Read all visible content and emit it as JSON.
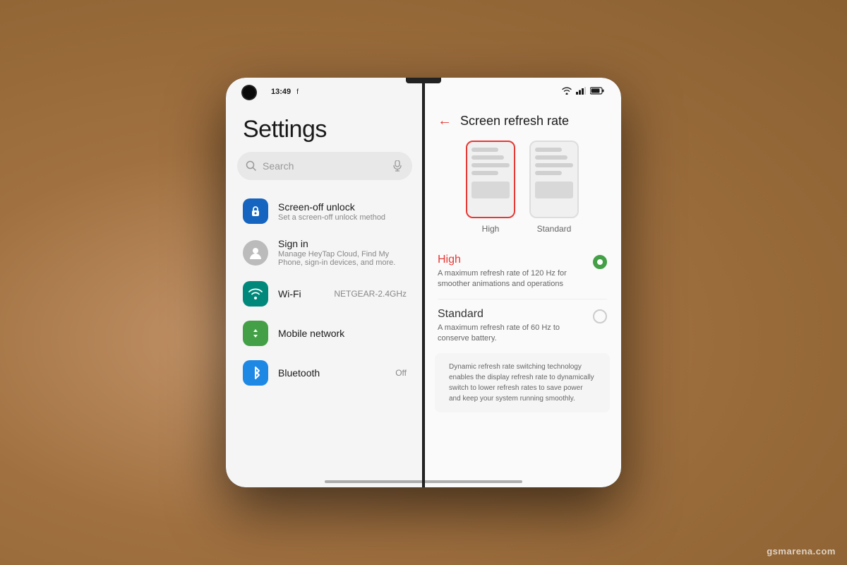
{
  "device": {
    "time": "13:49",
    "fb_indicator": "f",
    "wifi": "▲",
    "battery": "▮▮▮",
    "signal": "▮▮"
  },
  "left_panel": {
    "title": "Settings",
    "search": {
      "placeholder": "Search"
    },
    "items": [
      {
        "id": "screen-off-unlock",
        "icon": "🔒",
        "icon_color": "blue",
        "title": "Screen-off unlock",
        "subtitle": "Set a screen-off unlock method"
      },
      {
        "id": "sign-in",
        "icon": "👤",
        "icon_color": "gray",
        "title": "Sign in",
        "subtitle": "Manage HeyTap Cloud, Find My Phone, sign-in devices, and more."
      },
      {
        "id": "wifi",
        "icon": "wifi",
        "icon_color": "blue",
        "title": "Wi-Fi",
        "value": "NETGEAR-2.4GHz",
        "subtitle": ""
      },
      {
        "id": "mobile-network",
        "icon": "↑↓",
        "icon_color": "green",
        "title": "Mobile network",
        "subtitle": ""
      },
      {
        "id": "bluetooth",
        "icon": "bluetooth",
        "icon_color": "blue2",
        "title": "Bluetooth",
        "value": "Off",
        "subtitle": ""
      }
    ]
  },
  "right_panel": {
    "back_label": "←",
    "title": "Screen refresh rate",
    "options": [
      {
        "id": "high",
        "name": "High",
        "description": "A maximum refresh rate of 120 Hz for smoother animations and operations",
        "selected": true
      },
      {
        "id": "standard",
        "name": "Standard",
        "description": "A maximum refresh rate of 60 Hz to conserve battery.",
        "selected": false
      }
    ],
    "note": "Dynamic refresh rate switching technology enables the display refresh rate to dynamically switch to lower refresh rates to save power and keep your system running smoothly.",
    "illustration_labels": [
      "High",
      "Standard"
    ]
  },
  "watermark": "gsmarena.com"
}
